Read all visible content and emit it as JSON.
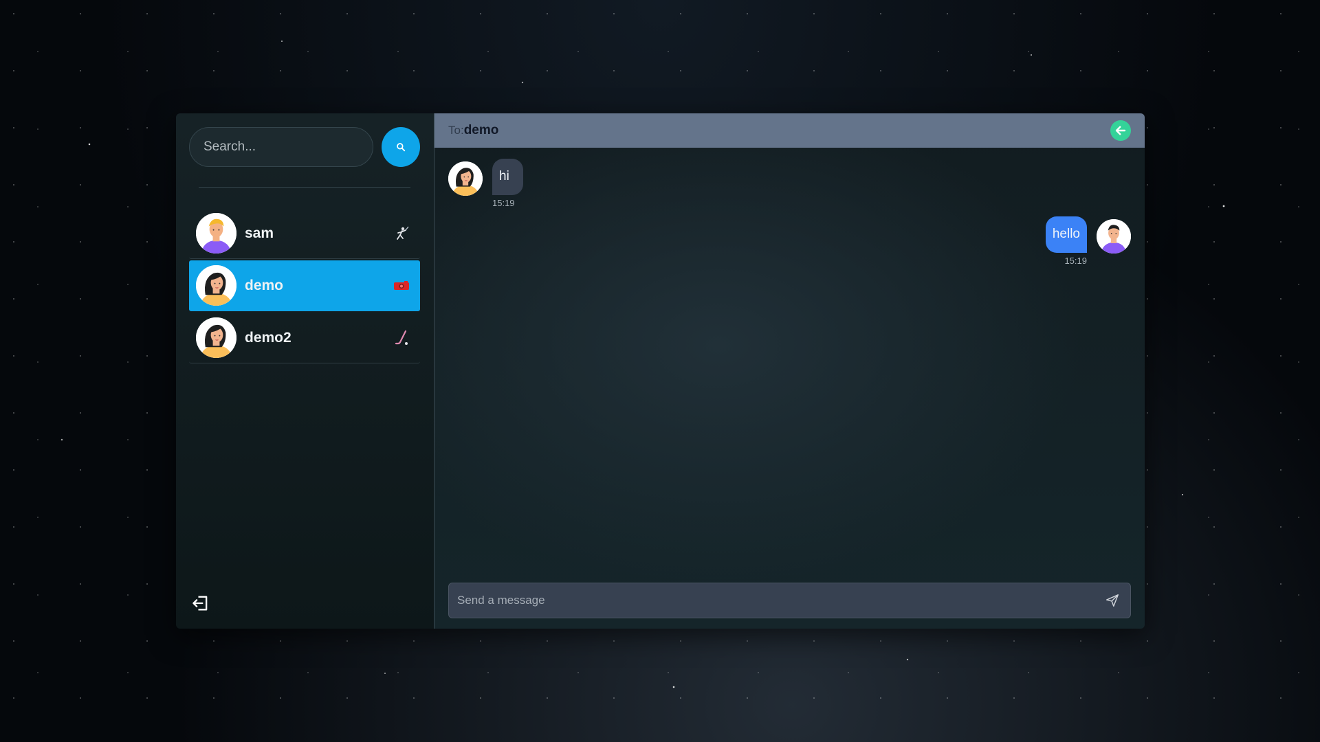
{
  "search": {
    "placeholder": "Search..."
  },
  "conversations": [
    {
      "name": "sam",
      "emoji_icon": "fencing-icon",
      "selected": false
    },
    {
      "name": "demo",
      "emoji_icon": "video-camera-icon",
      "selected": true
    },
    {
      "name": "demo2",
      "emoji_icon": "hockey-stick-icon",
      "selected": false
    }
  ],
  "chat": {
    "to_label": "To:",
    "recipient": "demo",
    "messages": [
      {
        "text": "hi",
        "time": "15:19",
        "direction": "incoming"
      },
      {
        "text": "hello",
        "time": "15:19",
        "direction": "outgoing"
      }
    ],
    "composer_placeholder": "Send a message"
  },
  "colors": {
    "accent": "#0ea5e9",
    "header": "#64748b",
    "outgoing_bubble": "#3b82f6",
    "incoming_bubble": "#374151",
    "back_button": "#34d399"
  }
}
